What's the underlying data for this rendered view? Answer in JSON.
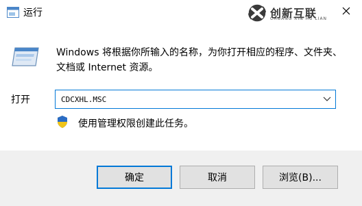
{
  "window": {
    "title": "运行",
    "close_icon": "close-icon",
    "app_icon": "run-dialog-icon"
  },
  "watermark": {
    "brand": "创新互联",
    "subtitle": "CHUANG XIN HU LIAN"
  },
  "dialog": {
    "description": "Windows 将根据你所输入的名称，为你打开相应的程序、文件夹、文档或 Internet 资源。",
    "open_label": "打开",
    "open_value": "CDCXHL.MSC",
    "admin_note": "使用管理权限创建此任务。"
  },
  "buttons": {
    "ok": "确定",
    "cancel": "取消",
    "browse": "浏览(B)..."
  },
  "colors": {
    "accent": "#0078d7",
    "footer_bg": "#f0f0f0",
    "button_bg": "#e1e1e1"
  }
}
